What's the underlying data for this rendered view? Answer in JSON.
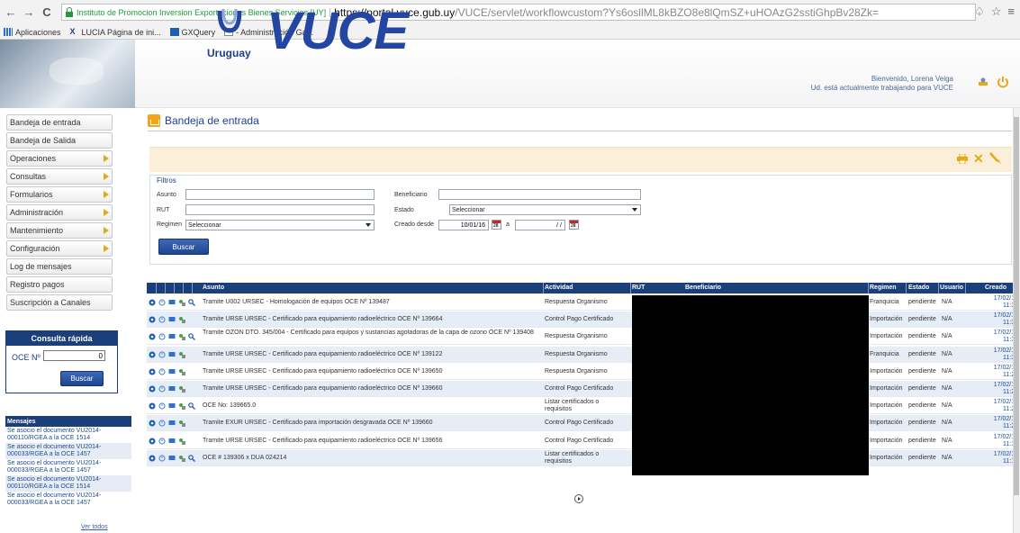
{
  "browser": {
    "ev_label": "Instituto de Promocion Inversion Exportaciones Bienes Servicios [UY]",
    "url_host": "https://portal.vuce.gub.uy",
    "url_path": "/VUCE/servlet/workflowcustom?Ys6osllML8kBZO8e8lQmSZ+uHOAzG2sstiGhpBv28Zk=",
    "bookmarks": [
      "Aplicaciones",
      "LUCIA Página de ini...",
      "GXQuery",
      "- Administración Ga..."
    ]
  },
  "banner": {
    "logo_text": "VUCE",
    "country": "Uruguay",
    "welcome_line1": "Bienvenido, Lorena Veiga",
    "welcome_line2": "Ud. está actualmente trabajando para VUCE",
    "brand_color": "#2446a3"
  },
  "sidebar": {
    "items": [
      {
        "label": "Bandeja de entrada",
        "submenu": false
      },
      {
        "label": "Bandeja de Salida",
        "submenu": false
      },
      {
        "label": "Operaciones",
        "submenu": true
      },
      {
        "label": "Consultas",
        "submenu": true
      },
      {
        "label": "Formularios",
        "submenu": true
      },
      {
        "label": "Administración",
        "submenu": true
      },
      {
        "label": "Mantenimiento",
        "submenu": true
      },
      {
        "label": "Configuración",
        "submenu": true
      },
      {
        "label": "Log de mensajes",
        "submenu": false
      },
      {
        "label": "Registro pagos",
        "submenu": false
      },
      {
        "label": "Suscripción a Canales",
        "submenu": false
      }
    ],
    "quick": {
      "title": "Consulta rápida",
      "label": "OCE Nº",
      "value": "0",
      "button": "Buscar"
    },
    "messages": {
      "title": "Mensajes",
      "items": [
        "Se asocio el documento VU2014-000110/RGEA a la OCE 1514",
        "Se asocio el documento VU2014-000033/RGEA a la OCE 1457",
        "Se asocio el documento VU2014-000033/RGEA a la OCE 1457",
        "Se asocio el documento VU2014-000110/RGEA a la OCE 1514",
        "Se asocio el documento VU2014-000033/RGEA a la OCE 1457"
      ],
      "see_all": "Ver todos"
    }
  },
  "main": {
    "title": "Bandeja de entrada",
    "filters": {
      "legend": "Filtros",
      "asunto_label": "Asunto",
      "asunto_value": "",
      "rut_label": "RUT",
      "rut_value": "",
      "regimen_label": "Regimen",
      "regimen_value": "Seleccionar",
      "beneficiario_label": "Beneficiario",
      "beneficiario_value": "",
      "estado_label": "Estado",
      "estado_value": "Seleccionar",
      "creado_label": "Creado desde",
      "creado_from": "10/01/16",
      "creado_sep": "a",
      "creado_to": "/ /",
      "button": "Buscar"
    },
    "table": {
      "headers": {
        "asunto": "Asunto",
        "actividad": "Actividad",
        "rut": "RUT",
        "beneficiario": "Beneficiario",
        "regimen": "Regimen",
        "estado": "Estado",
        "usuario": "Usuario",
        "creado": "Creado"
      },
      "rows": [
        {
          "asunto": "Tramite U002 URSEC - Homologación de equipos OCE Nº 139487",
          "actividad": "Respuesta Organismo",
          "regimen": "Franquicia",
          "estado": "pendiente",
          "usuario": "N/A",
          "fecha": "17/02/16",
          "hora": "11:37"
        },
        {
          "asunto": "Tramite URSE URSEC - Certificado para equipamiento radioeléctrico OCE Nº 139664",
          "actividad": "Control Pago Certificado",
          "regimen": "Importación",
          "estado": "pendiente",
          "usuario": "N/A",
          "fecha": "17/02/16",
          "hora": "11:32"
        },
        {
          "asunto": "Tramite OZON DTO. 345/004 - Certificado para equipos y sustancias agotadoras de la capa de ozono OCE Nº 139408",
          "actividad": "Respuesta Organismo",
          "regimen": "Importación",
          "estado": "pendiente",
          "usuario": "N/A",
          "fecha": "17/02/16",
          "hora": "11:32"
        },
        {
          "asunto": "Tramite URSE URSEC - Certificado para equipamiento radioeléctrico OCE Nº 139122",
          "actividad": "Respuesta Organismo",
          "regimen": "Franquicia",
          "estado": "pendiente",
          "usuario": "N/A",
          "fecha": "17/02/16",
          "hora": "11:31"
        },
        {
          "asunto": "Tramite URSE URSEC - Certificado para equipamiento radioeléctrico OCE Nº 139650",
          "actividad": "Respuesta Organismo",
          "regimen": "Importación",
          "estado": "pendiente",
          "usuario": "N/A",
          "fecha": "17/02/16",
          "hora": "11:26"
        },
        {
          "asunto": "Tramite URSE URSEC - Certificado para equipamiento radioeléctrico OCE Nº 139660",
          "actividad": "Control Pago Certificado",
          "regimen": "Importación",
          "estado": "pendiente",
          "usuario": "N/A",
          "fecha": "17/02/16",
          "hora": "11:26"
        },
        {
          "asunto": "OCE No: 139665.0",
          "actividad": "Listar certificados o requisitos",
          "regimen": "Importación",
          "estado": "pendiente",
          "usuario": "N/A",
          "fecha": "17/02/16",
          "hora": "11:25"
        },
        {
          "asunto": "Tramite EXUR URSEC - Certificado para importación desgravada OCE Nº 139660",
          "actividad": "Control Pago Certificado",
          "regimen": "Importación",
          "estado": "pendiente",
          "usuario": "N/A",
          "fecha": "17/02/16",
          "hora": "11:23"
        },
        {
          "asunto": "Tramite URSE URSEC - Certificado para equipamiento radioeléctrico OCE Nº 139656",
          "actividad": "Control Pago Certificado",
          "regimen": "Importación",
          "estado": "pendiente",
          "usuario": "N/A",
          "fecha": "17/02/16",
          "hora": "11:16"
        },
        {
          "asunto": "OCE # 139306 x DUA 024214",
          "actividad": "Listar certificados o requisitos",
          "regimen": "Importación",
          "estado": "pendiente",
          "usuario": "N/A",
          "fecha": "17/02/16",
          "hora": "11:10"
        }
      ]
    }
  },
  "colors": {
    "nav_dark": "#1a3f7a",
    "accent_orange": "#e6a817",
    "row_alt": "#e6edf7",
    "action_bar": "#fcefd9"
  }
}
